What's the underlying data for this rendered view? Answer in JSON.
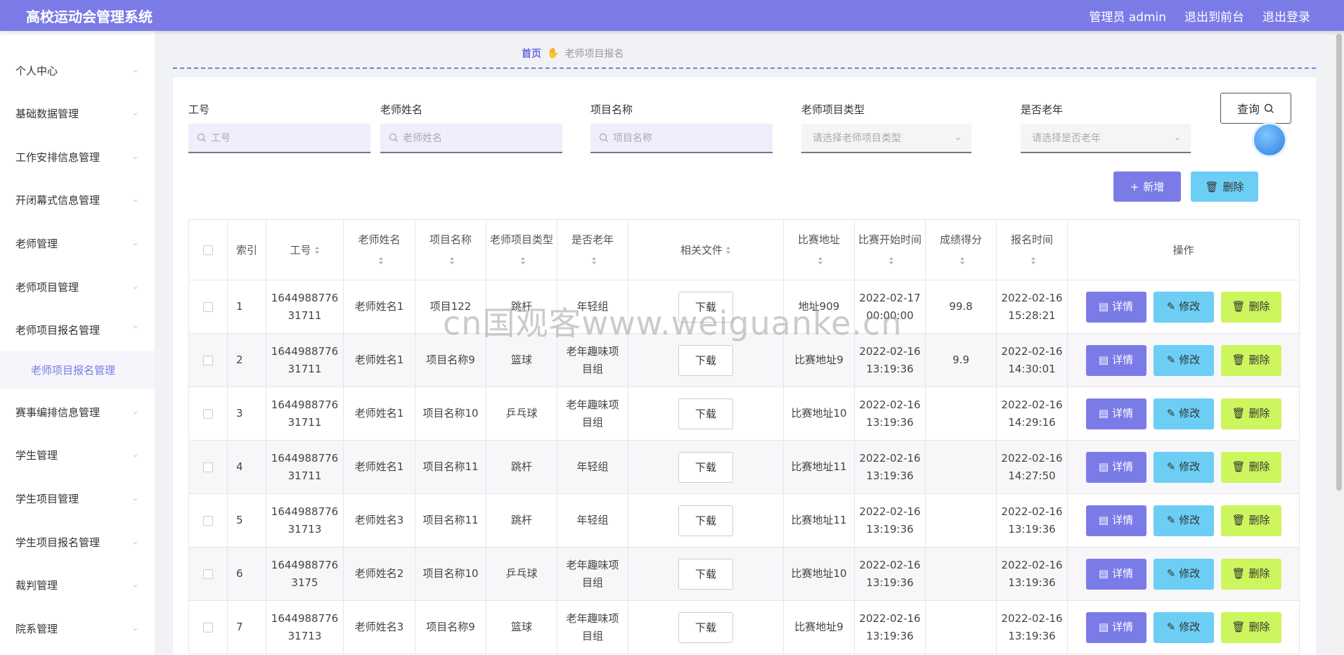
{
  "header": {
    "title": "高校运动会管理系统",
    "admin_label": "管理员 admin",
    "front_label": "退出到前台",
    "logout_label": "退出登录"
  },
  "sidebar": {
    "items": [
      {
        "label": "个人中心"
      },
      {
        "label": "基础数据管理"
      },
      {
        "label": "工作安排信息管理"
      },
      {
        "label": "开闭幕式信息管理"
      },
      {
        "label": "老师管理"
      },
      {
        "label": "老师项目管理"
      },
      {
        "label": "老师项目报名管理"
      },
      {
        "label": "赛事编排信息管理"
      },
      {
        "label": "学生管理"
      },
      {
        "label": "学生项目管理"
      },
      {
        "label": "学生项目报名管理"
      },
      {
        "label": "裁判管理"
      },
      {
        "label": "院系管理"
      }
    ],
    "active_sub": "老师项目报名管理"
  },
  "breadcrumb": {
    "home": "首页",
    "current": "老师项目报名"
  },
  "search": {
    "f1": {
      "label": "工号",
      "placeholder": "工号"
    },
    "f2": {
      "label": "老师姓名",
      "placeholder": "老师姓名"
    },
    "f3": {
      "label": "项目名称",
      "placeholder": "项目名称"
    },
    "f4": {
      "label": "老师项目类型",
      "placeholder": "请选择老师项目类型"
    },
    "f5": {
      "label": "是否老年",
      "placeholder": "请选择是否老年"
    },
    "query_label": "查询"
  },
  "actions": {
    "add_label": "新增",
    "delete_label": "删除"
  },
  "table": {
    "headers": {
      "idx": "索引",
      "no": "工号",
      "name": "老师姓名",
      "project": "项目名称",
      "type": "老师项目类型",
      "old": "是否老年",
      "file": "相关文件",
      "addr": "比赛地址",
      "start": "比赛开始时间",
      "score": "成绩得分",
      "signup": "报名时间",
      "ops": "操作"
    },
    "download_label": "下载",
    "op_detail": "详情",
    "op_edit": "修改",
    "op_delete": "删除",
    "rows": [
      {
        "idx": "1",
        "no": "164498877631711",
        "name": "老师姓名1",
        "project": "项目122",
        "type": "跳杆",
        "old": "年轻组",
        "addr": "地址909",
        "start": "2022-02-17 00:00:00",
        "score": "99.8",
        "signup": "2022-02-16 15:28:21"
      },
      {
        "idx": "2",
        "no": "164498877631711",
        "name": "老师姓名1",
        "project": "项目名称9",
        "type": "篮球",
        "old": "老年趣味项目组",
        "addr": "比赛地址9",
        "start": "2022-02-16 13:19:36",
        "score": "9.9",
        "signup": "2022-02-16 14:30:01"
      },
      {
        "idx": "3",
        "no": "164498877631711",
        "name": "老师姓名1",
        "project": "项目名称10",
        "type": "乒乓球",
        "old": "老年趣味项目组",
        "addr": "比赛地址10",
        "start": "2022-02-16 13:19:36",
        "score": "",
        "signup": "2022-02-16 14:29:16"
      },
      {
        "idx": "4",
        "no": "164498877631711",
        "name": "老师姓名1",
        "project": "项目名称11",
        "type": "跳杆",
        "old": "年轻组",
        "addr": "比赛地址11",
        "start": "2022-02-16 13:19:36",
        "score": "",
        "signup": "2022-02-16 14:27:50"
      },
      {
        "idx": "5",
        "no": "164498877631713",
        "name": "老师姓名3",
        "project": "项目名称11",
        "type": "跳杆",
        "old": "年轻组",
        "addr": "比赛地址11",
        "start": "2022-02-16 13:19:36",
        "score": "",
        "signup": "2022-02-16 13:19:36"
      },
      {
        "idx": "6",
        "no": "16449887763175",
        "name": "老师姓名2",
        "project": "项目名称10",
        "type": "乒乓球",
        "old": "老年趣味项目组",
        "addr": "比赛地址10",
        "start": "2022-02-16 13:19:36",
        "score": "",
        "signup": "2022-02-16 13:19:36"
      },
      {
        "idx": "7",
        "no": "164498877631713",
        "name": "老师姓名3",
        "project": "项目名称9",
        "type": "篮球",
        "old": "老年趣味项目组",
        "addr": "比赛地址9",
        "start": "2022-02-16 13:19:36",
        "score": "",
        "signup": "2022-02-16 13:19:36"
      }
    ]
  },
  "watermark": "cn国观客www.weiguanke.cn",
  "colors": {
    "primary": "#7b7be8",
    "cyan": "#6ccef5",
    "lime": "#cdf55d"
  }
}
